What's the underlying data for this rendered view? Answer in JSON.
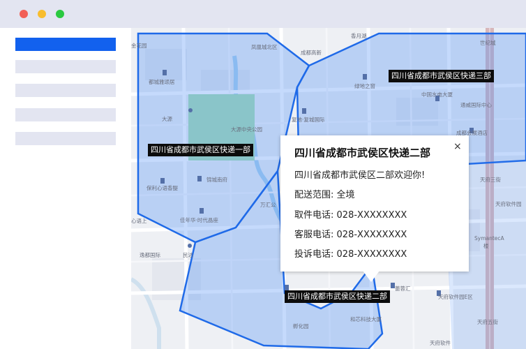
{
  "window": {
    "traffic_lights": [
      {
        "name": "close",
        "color": "#f25f57"
      },
      {
        "name": "minimize",
        "color": "#f8bd2e"
      },
      {
        "name": "maximize",
        "color": "#2ac940"
      }
    ]
  },
  "sidebar": {
    "items": [
      {
        "state": "active"
      },
      {
        "state": "inactive"
      },
      {
        "state": "inactive"
      },
      {
        "state": "inactive"
      },
      {
        "state": "inactive"
      }
    ]
  },
  "map": {
    "zones": [
      {
        "label": "四川省成都市武侯区快递一部"
      },
      {
        "label": "四川省成都市武侯区快递二部"
      },
      {
        "label": "四川省成都市武侯区快递三部"
      }
    ],
    "pois": [
      {
        "text": "香月湖"
      },
      {
        "text": "世纪城"
      },
      {
        "text": "金花园"
      },
      {
        "text": "凤凰城北区"
      },
      {
        "text": "成都高新"
      },
      {
        "text": "绿地之窗"
      },
      {
        "text": "都城雅颂居"
      },
      {
        "text": "中国水电大厦"
      },
      {
        "text": "通威国际中心"
      },
      {
        "text": "大源"
      },
      {
        "text": "大源中央公园"
      },
      {
        "text": "复地·复城国际"
      },
      {
        "text": "成都会展酒店"
      },
      {
        "text": "锦城南府"
      },
      {
        "text": "保利心语香醍"
      },
      {
        "text": "万汇公"
      },
      {
        "text": "佳年华·时代晶座"
      },
      {
        "text": "心语上"
      },
      {
        "text": "逸都国际"
      },
      {
        "text": "民达"
      },
      {
        "text": "天府三街"
      },
      {
        "text": "天府软件园"
      },
      {
        "text": "SymantecA"
      },
      {
        "text": "楼"
      },
      {
        "text": "蕾蓉汇"
      },
      {
        "text": "天府软件园E区"
      },
      {
        "text": "天府五街"
      },
      {
        "text": "和芯科技大厦"
      },
      {
        "text": "孵化园"
      },
      {
        "text": "天府软件"
      }
    ]
  },
  "popup": {
    "title": "四川省成都市武侯区快递二部",
    "welcome": "四川省成都市武侯区二部欢迎你!",
    "scope_label": "配送范围:",
    "scope_value": "全境",
    "pickup_label": "取件电话:",
    "pickup_value": "028-XXXXXXXX",
    "service_label": "客服电话:",
    "service_value": "028-XXXXXXXX",
    "complaint_label": "投诉电话:",
    "complaint_value": "028-XXXXXXXX",
    "close_glyph": "×"
  }
}
